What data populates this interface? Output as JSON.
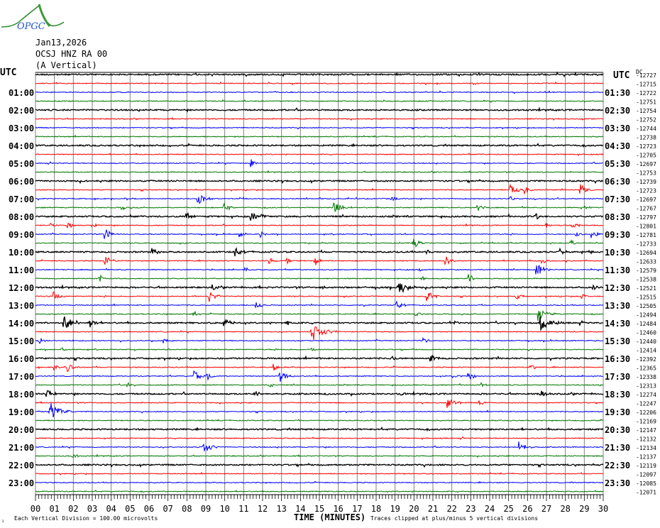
{
  "header": {
    "logo_text": "OPGC",
    "date": "Jan13,2026",
    "station": "OCSJ HNZ RA 00",
    "component": "(A Vertical)",
    "dc_label": "DC"
  },
  "chart_data": {
    "type": "line",
    "title": "OCSJ HNZ RA 00 (A Vertical) Jan13,2026",
    "xlabel": "TIME (MINUTES)",
    "xlim": [
      0,
      30
    ],
    "x_ticks": [
      "00",
      "01",
      "02",
      "03",
      "04",
      "05",
      "06",
      "07",
      "08",
      "09",
      "10",
      "11",
      "12",
      "13",
      "14",
      "15",
      "16",
      "17",
      "18",
      "19",
      "20",
      "21",
      "22",
      "23",
      "24",
      "25",
      "26",
      "27",
      "28",
      "29",
      "30"
    ],
    "left_label_header": "UTC",
    "right_label_header": "UTC",
    "left_labels": [
      "01:00",
      "02:00",
      "03:00",
      "04:00",
      "05:00",
      "06:00",
      "07:00",
      "08:00",
      "09:00",
      "10:00",
      "11:00",
      "12:00",
      "13:00",
      "14:00",
      "15:00",
      "16:00",
      "17:00",
      "18:00",
      "19:00",
      "20:00",
      "21:00",
      "22:00",
      "23:00"
    ],
    "right_labels": [
      "01:30",
      "02:30",
      "03:30",
      "04:30",
      "05:30",
      "06:30",
      "07:30",
      "08:30",
      "09:30",
      "10:30",
      "11:30",
      "12:30",
      "13:30",
      "14:30",
      "15:30",
      "16:30",
      "17:30",
      "18:30",
      "19:30",
      "20:30",
      "21:30",
      "22:30",
      "23:30"
    ],
    "dc_offsets": [
      "-12727",
      "-12715",
      "-12722",
      "-12751",
      "-12754",
      "-12752",
      "-12744",
      "-12738",
      "-12723",
      "-12705",
      "-12697",
      "-12753",
      "-12739",
      "-12723",
      "-12697",
      "-12767",
      "-12797",
      "-12801",
      "-12781",
      "-12733",
      "-12694",
      "-12633",
      "-12579",
      "-12538",
      "-12521",
      "-12515",
      "-12505",
      "-12494",
      "-12484",
      "-12460",
      "-12440",
      "-12414",
      "-12392",
      "-12365",
      "-12338",
      "-12313",
      "-12274",
      "-12247",
      "-12206",
      "-12169",
      "-12147",
      "-12132",
      "-12134",
      "-12137",
      "-12119",
      "-12097",
      "-12085",
      "-12071"
    ],
    "trace_colors": [
      "#000000",
      "#ff0000",
      "#0000ff",
      "#007700"
    ],
    "rows": 48,
    "minutes_per_row": 30,
    "scale_note": "Each Vertical Division =  100.00 microvolts",
    "clip_note": "Traces clipped at plus/minus 5 vertical divisions",
    "corner_mark": "₁",
    "events": [
      [
        10,
        11.4,
        6
      ],
      [
        13,
        25.1,
        8
      ],
      [
        13,
        25.9,
        5
      ],
      [
        13,
        28.8,
        8
      ],
      [
        14,
        8.55,
        9
      ],
      [
        14,
        18.8,
        4
      ],
      [
        14,
        25.1,
        4
      ],
      [
        15,
        4.6,
        3
      ],
      [
        15,
        10.0,
        6
      ],
      [
        15,
        15.8,
        9
      ],
      [
        15,
        23.4,
        5
      ],
      [
        15,
        28.9,
        6
      ],
      [
        16,
        8.0,
        8
      ],
      [
        16,
        11.4,
        7
      ],
      [
        16,
        11.9,
        5
      ],
      [
        16,
        26.4,
        5
      ],
      [
        17,
        0.8,
        4
      ],
      [
        17,
        1.7,
        5
      ],
      [
        17,
        3.0,
        4
      ],
      [
        17,
        27.0,
        4
      ],
      [
        17,
        28.4,
        5
      ],
      [
        18,
        3.7,
        7
      ],
      [
        18,
        10.8,
        5
      ],
      [
        18,
        11.9,
        4
      ],
      [
        18,
        28.6,
        4
      ],
      [
        18,
        29.4,
        6
      ],
      [
        19,
        19.95,
        8
      ],
      [
        19,
        28.3,
        4
      ],
      [
        20,
        6.2,
        6
      ],
      [
        20,
        10.6,
        7
      ],
      [
        20,
        20.7,
        5
      ],
      [
        20,
        27.7,
        5
      ],
      [
        20,
        29.3,
        3
      ],
      [
        21,
        3.7,
        7
      ],
      [
        21,
        12.4,
        4
      ],
      [
        21,
        13.3,
        4
      ],
      [
        21,
        14.8,
        6
      ],
      [
        21,
        21.7,
        6
      ],
      [
        21,
        26.8,
        5
      ],
      [
        22,
        11.1,
        4
      ],
      [
        22,
        20.3,
        3
      ],
      [
        22,
        26.5,
        9
      ],
      [
        23,
        3.4,
        5
      ],
      [
        23,
        20.4,
        3
      ],
      [
        23,
        22.9,
        7
      ],
      [
        24,
        9.4,
        4
      ],
      [
        24,
        15.2,
        2
      ],
      [
        24,
        19.2,
        11
      ],
      [
        24,
        29.4,
        5
      ],
      [
        25,
        1.0,
        6
      ],
      [
        25,
        9.2,
        8
      ],
      [
        25,
        20.7,
        8
      ],
      [
        25,
        25.4,
        5
      ],
      [
        25,
        28.9,
        4
      ],
      [
        26,
        11.7,
        5
      ],
      [
        26,
        19.1,
        7
      ],
      [
        27,
        8.3,
        5
      ],
      [
        27,
        20.1,
        4
      ],
      [
        27,
        26.6,
        10
      ],
      [
        28,
        1.5,
        12
      ],
      [
        28,
        2.9,
        6
      ],
      [
        28,
        10.0,
        7
      ],
      [
        28,
        13.3,
        3
      ],
      [
        28,
        22.1,
        3
      ],
      [
        28,
        26.7,
        12
      ],
      [
        28,
        28.8,
        4
      ],
      [
        29,
        14.6,
        14
      ],
      [
        30,
        0.2,
        5
      ],
      [
        30,
        6.8,
        5
      ],
      [
        30,
        20.5,
        4
      ],
      [
        31,
        1.4,
        4
      ],
      [
        31,
        14.6,
        3
      ],
      [
        32,
        18.8,
        4
      ],
      [
        32,
        20.9,
        6
      ],
      [
        33,
        1.0,
        4
      ],
      [
        33,
        1.7,
        6
      ],
      [
        33,
        12.6,
        5
      ],
      [
        33,
        26.2,
        4
      ],
      [
        34,
        8.4,
        8
      ],
      [
        34,
        9.1,
        5
      ],
      [
        34,
        12.9,
        9
      ],
      [
        34,
        22.1,
        4
      ],
      [
        34,
        22.9,
        6
      ],
      [
        35,
        4.9,
        3
      ],
      [
        35,
        12.4,
        4
      ],
      [
        35,
        23.6,
        3
      ],
      [
        36,
        0.6,
        6
      ],
      [
        36,
        11.6,
        5
      ],
      [
        36,
        15.3,
        4
      ],
      [
        36,
        19.2,
        4
      ],
      [
        36,
        26.7,
        6
      ],
      [
        37,
        21.8,
        8
      ],
      [
        37,
        23.5,
        4
      ],
      [
        38,
        0.75,
        14
      ],
      [
        42,
        8.9,
        9
      ],
      [
        42,
        25.6,
        8
      ],
      [
        43,
        2.0,
        4
      ]
    ]
  }
}
